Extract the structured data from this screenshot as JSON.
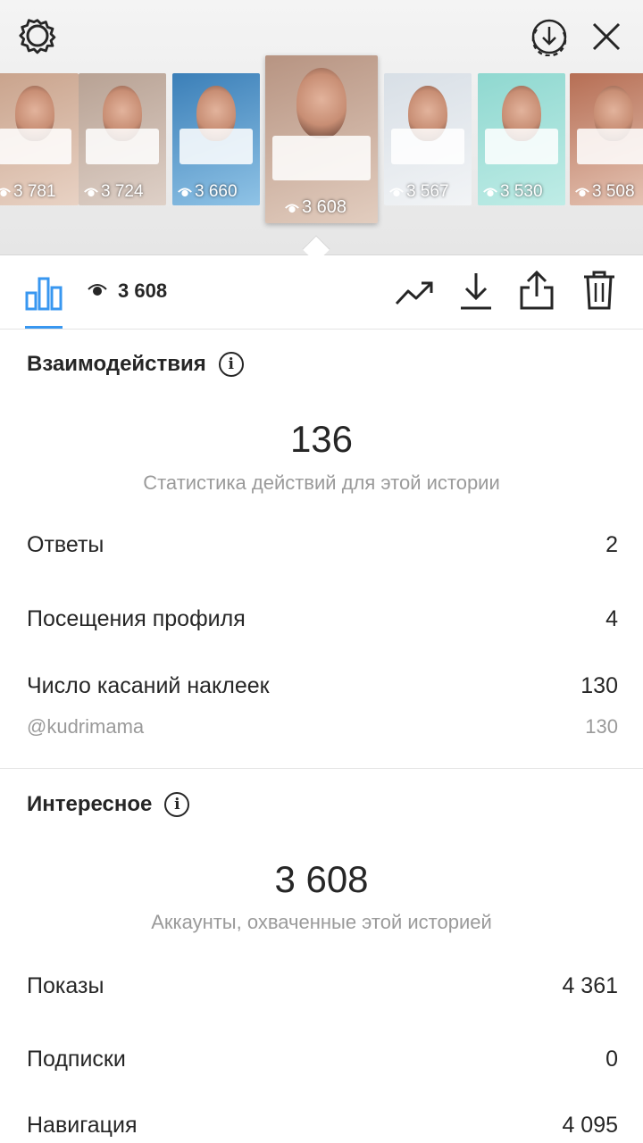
{
  "header": {
    "settings_icon": "gear-icon",
    "save_icon": "download-circle-icon",
    "close_icon": "close-icon"
  },
  "stories": [
    {
      "views": "3 781",
      "colors": [
        "#c9a38c",
        "#e8d2c4"
      ]
    },
    {
      "views": "3 724",
      "colors": [
        "#b8a294",
        "#ded0c7"
      ]
    },
    {
      "views": "3 660",
      "colors": [
        "#3b7fb8",
        "#8fc3e6"
      ]
    },
    {
      "views": "3 608",
      "colors": [
        "#b79482",
        "#e2cdbf"
      ]
    },
    {
      "views": "3 567",
      "colors": [
        "#d8dfe6",
        "#f2f4f6"
      ]
    },
    {
      "views": "3 530",
      "colors": [
        "#8fd8d0",
        "#bfece6"
      ]
    },
    {
      "views": "3 508",
      "colors": [
        "#b66e54",
        "#e6c6b6"
      ]
    }
  ],
  "current_story_index": 3,
  "toolbar": {
    "views_count": "3 608",
    "icons": [
      "bar-chart-icon",
      "eye-icon",
      "trend-icon",
      "download-icon",
      "share-icon",
      "trash-icon"
    ]
  },
  "interactions": {
    "title": "Взаимодействия",
    "total": "136",
    "caption": "Статистика действий для этой истории",
    "rows": [
      {
        "label": "Ответы",
        "value": "2"
      },
      {
        "label": "Посещения профиля",
        "value": "4"
      },
      {
        "label": "Число касаний наклеек",
        "value": "130"
      }
    ],
    "sub_row": {
      "label": "@kudrimama",
      "value": "130"
    }
  },
  "discovery": {
    "title": "Интересное",
    "total": "3 608",
    "caption": "Аккаунты, охваченные этой историей",
    "rows": [
      {
        "label": "Показы",
        "value": "4 361"
      },
      {
        "label": "Подписки",
        "value": "0"
      },
      {
        "label": "Навигация",
        "value": "4 095"
      }
    ]
  },
  "colors": {
    "accent": "#3897f0",
    "text": "#262626",
    "secondary_text": "#9a9a9a",
    "sticker_tag": "#c2185b"
  }
}
